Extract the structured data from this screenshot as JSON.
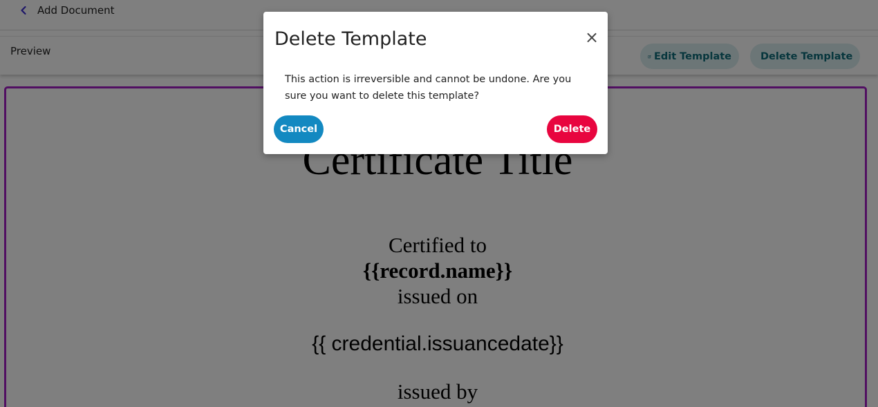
{
  "header": {
    "back_label": "Add Document"
  },
  "toolbar": {
    "preview_label": "Preview",
    "edit_template_label": "Edit Template",
    "delete_template_label": "Delete Template"
  },
  "certificate": {
    "title": "Certificate Title",
    "certified_to": "Certified to",
    "record_name": "{{record.name}}",
    "issued_on": "issued on",
    "issuance_date": "{{ credential.issuancedate}}",
    "issued_by": "issued by"
  },
  "modal": {
    "title": "Delete Template",
    "close_symbol": "×",
    "message": "This action is irreversible and cannot be undone. Are you sure you want to delete this template?",
    "cancel_label": "Cancel",
    "delete_label": "Delete"
  },
  "icons": {
    "back": "chevron-left-icon",
    "edit": "pencil-square-icon",
    "delete": "trash-icon",
    "close": "close-icon"
  },
  "colors": {
    "accent_teal": "#0f6c7a",
    "button_bg_light": "#d8ecef",
    "cancel_blue": "#1389c1",
    "delete_red": "#e8053f",
    "certificate_border": "#a31fc4",
    "back_chevron": "#3b2bd1"
  }
}
